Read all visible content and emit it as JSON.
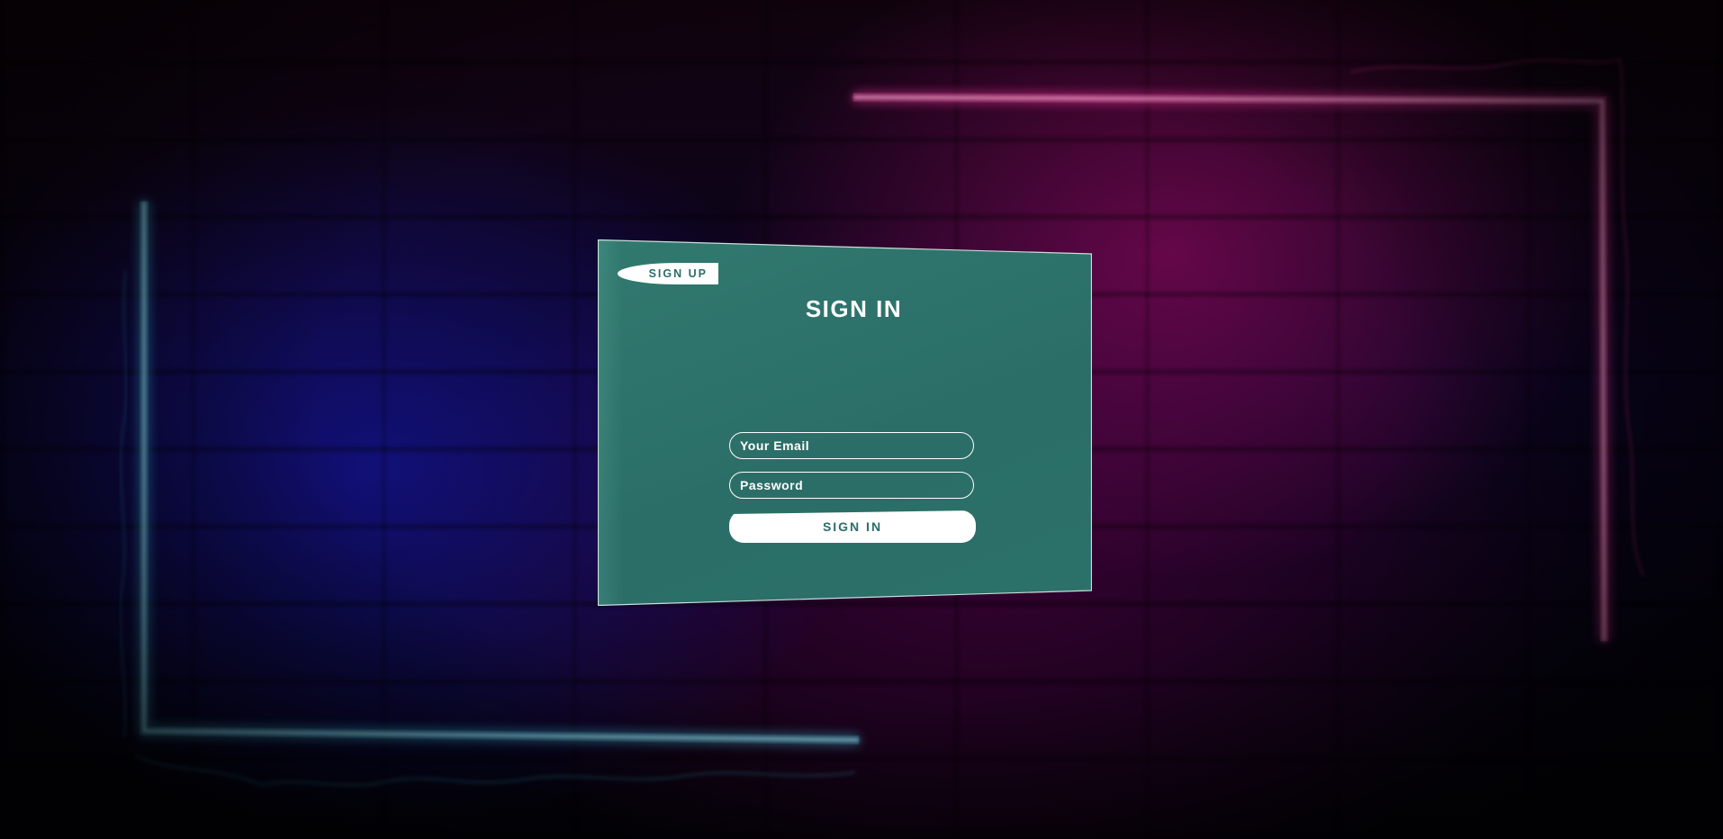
{
  "signup_tab": {
    "label": "SIGN UP"
  },
  "form": {
    "title": "SIGN IN",
    "email_placeholder": "Your Email",
    "password_placeholder": "Password",
    "submit_label": "SIGN IN"
  },
  "colors": {
    "card": "#2b6e68",
    "neon_blue": "#3ab9d6",
    "neon_pink": "#ff3ea5"
  }
}
